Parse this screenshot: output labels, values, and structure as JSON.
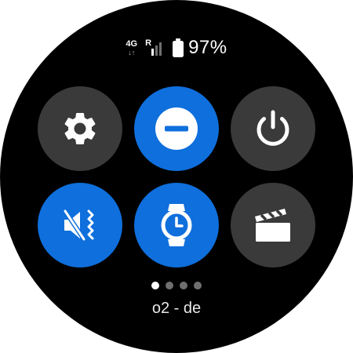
{
  "status": {
    "network_type": "4G",
    "network_arrows": "↓↑",
    "roaming": "R",
    "battery_percent": "97%"
  },
  "tiles": [
    {
      "icon": "gear-icon",
      "state": "off"
    },
    {
      "icon": "do-not-disturb-icon",
      "state": "on"
    },
    {
      "icon": "power-icon",
      "state": "off"
    },
    {
      "icon": "vibrate-mute-icon",
      "state": "on"
    },
    {
      "icon": "watch-face-icon",
      "state": "on"
    },
    {
      "icon": "clapperboard-icon",
      "state": "off"
    }
  ],
  "pager": {
    "count": 4,
    "active": 1
  },
  "carrier": "o2 - de",
  "colors": {
    "accent": "#0f6fdc",
    "tile_off": "#3a3a3a",
    "background": "#000000"
  }
}
